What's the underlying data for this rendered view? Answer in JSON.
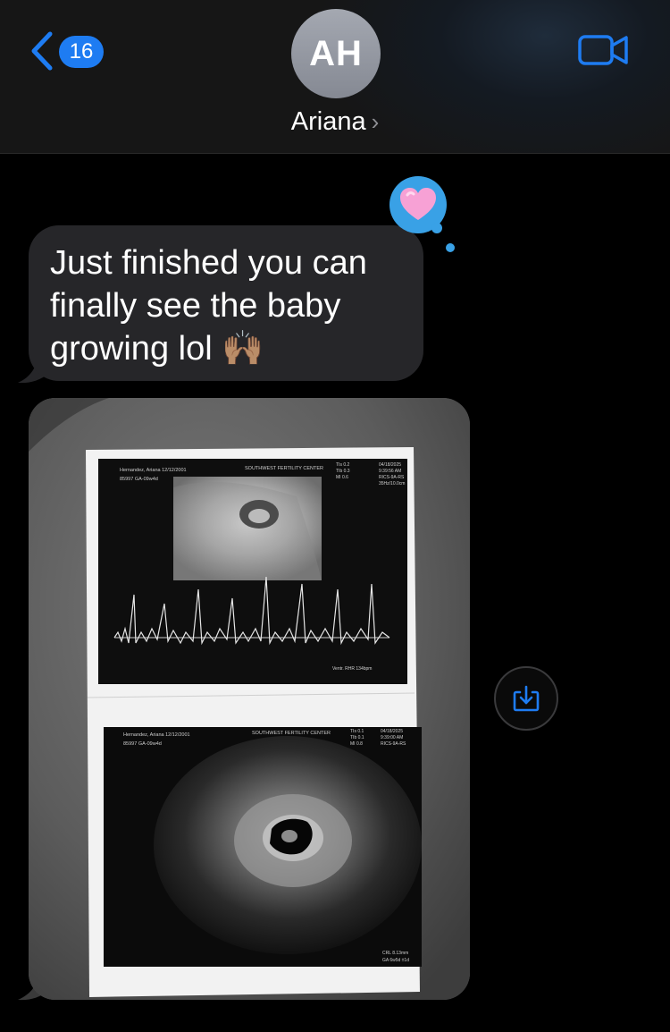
{
  "header": {
    "back_count": "16",
    "avatar_initials": "AH",
    "contact_name": "Ariana",
    "contact_chevron": "›"
  },
  "messages": [
    {
      "type": "text",
      "text": "Just finished you can finally see the baby growing lol 🙌🏽",
      "reaction": "heart-tapback"
    },
    {
      "type": "image"
    }
  ],
  "photo": {
    "sheet_top": {
      "patient": "Hernandez, Ariana 12/12/2001",
      "id_line": "85997 GA-09w4d",
      "clinic": "SOUTHWEST FERTILITY CENTER",
      "tis_lines": [
        "TIs 0.2",
        "TIb 0.3",
        "MI 0.6"
      ],
      "date_time": [
        "04/18/2025",
        "9:39:56 AM",
        "RICS-9A-RS",
        "35Hz/10.0cm"
      ],
      "heart_rate": "Ventr. RHR 134bpm"
    },
    "sheet_bottom": {
      "patient": "Hernandez, Ariana 12/12/2001",
      "id_line": "85997 GA-09w4d",
      "clinic": "SOUTHWEST FERTILITY CENTER",
      "tis_lines": [
        "TIs 0.1",
        "TIb 0.1",
        "MI 0.8"
      ],
      "date_time": [
        "04/18/2025",
        "9:39:00 AM",
        "RICS-9A-RS"
      ],
      "measure": [
        "CRL 8.13mm",
        "GA 6w5d ±1d"
      ]
    }
  },
  "icons": {
    "back": "chevron-left-icon",
    "video": "video-camera-icon",
    "save": "save-to-photos-icon",
    "reaction": "pink-heart-icon"
  },
  "colors": {
    "accent": "#1e7cf2",
    "bubble": "#262629",
    "tapback": "#39a1e6"
  }
}
